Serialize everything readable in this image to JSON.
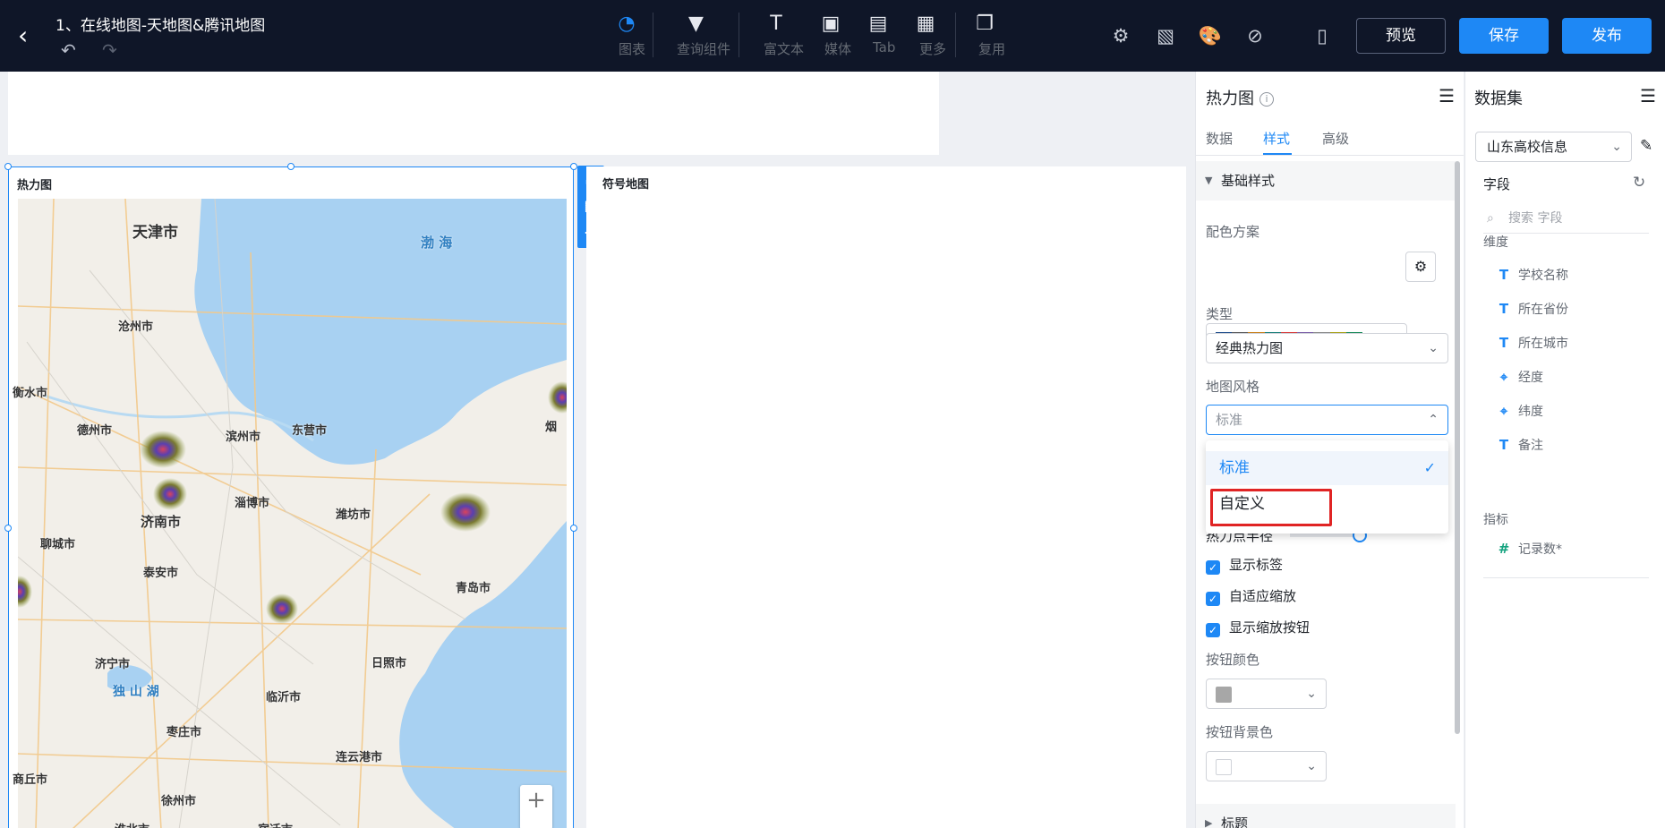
{
  "app": {
    "title": "1、在线地图-天地图&腾讯地图",
    "back_icon": "‹",
    "undo_icon": "↶",
    "redo_icon": "↷"
  },
  "toolbar": {
    "tools": [
      {
        "label": "图表",
        "icon": "◔"
      },
      {
        "label": "查询组件",
        "icon": "▼"
      },
      {
        "label": "富文本",
        "icon": "T"
      },
      {
        "label": "媒体",
        "icon": "▣"
      },
      {
        "label": "Tab",
        "icon": "▤"
      },
      {
        "label": "更多",
        "icon": "▦"
      },
      {
        "label": "复用",
        "icon": "❐"
      }
    ],
    "right_icons": [
      "⚙",
      "▧",
      "🎨",
      "⊘",
      "▯"
    ],
    "preview_label": "预览",
    "save_label": "保存",
    "publish_label": "发布"
  },
  "canvas": {
    "heatmap_card_title": "热力图",
    "second_card_title": "符号地图",
    "map_labels": [
      {
        "text": "天津市"
      },
      {
        "text": "渤 海"
      },
      {
        "text": "沧州市"
      },
      {
        "text": "衡水市"
      },
      {
        "text": "德州市"
      },
      {
        "text": "滨州市"
      },
      {
        "text": "东营市"
      },
      {
        "text": "淄博市"
      },
      {
        "text": "潍坊市"
      },
      {
        "text": "济南市"
      },
      {
        "text": "聊城市"
      },
      {
        "text": "泰安市"
      },
      {
        "text": "济宁市"
      },
      {
        "text": "独 山 湖"
      },
      {
        "text": "日照市"
      },
      {
        "text": "临沂市"
      },
      {
        "text": "枣庄市"
      },
      {
        "text": "连云港市"
      },
      {
        "text": "徐州市"
      },
      {
        "text": "淮北市"
      },
      {
        "text": "宿迁市"
      },
      {
        "text": "商丘市"
      },
      {
        "text": "烟"
      },
      {
        "text": "青岛市"
      }
    ],
    "side_tool_icons": [
      "⤢",
      "▤",
      "⋯"
    ],
    "zoom_icon": "+"
  },
  "config": {
    "header": "热力图",
    "info_icon": "i",
    "menu_icon": "☰",
    "tabs": [
      "数据",
      "样式",
      "高级"
    ],
    "active_tab": "样式",
    "section_basic": "基础样式",
    "palette_label": "配色方案",
    "palette_colors": [
      "#1f4e8c",
      "#5a5a5a",
      "#c77f1a",
      "#1a7f7a",
      "#d63b3b",
      "#7b5ea7",
      "#8a8a8a",
      "#a8a21a",
      "#1a8a5a"
    ],
    "type_label": "类型",
    "type_value": "经典热力图",
    "mapstyle_label": "地图风格",
    "mapstyle_value": "标准",
    "dropdown_options": [
      "标准",
      "自定义"
    ],
    "check_icon": "✓",
    "radius_label": "热力点半径",
    "checkbox_labels": [
      "显示标签",
      "自适应缩放",
      "显示缩放按钮"
    ],
    "button_color_label": "按钮颜色",
    "button_bg_label": "按钮背景色",
    "button_color_swatch": "#a7a7a7",
    "button_bg_swatch": "#ffffff",
    "section_title": "标题"
  },
  "dataset": {
    "header": "数据集",
    "menu_icon": "☰",
    "selected_dataset": "山东高校信息",
    "edit_icon": "✎",
    "fields_label": "字段",
    "refresh_icon": "↻",
    "search_placeholder": "搜索 字段",
    "search_icon": "⌕",
    "dimension_label": "维度",
    "dimensions": [
      {
        "name": "学校名称",
        "icon": "T"
      },
      {
        "name": "所在省份",
        "icon": "T"
      },
      {
        "name": "所在城市",
        "icon": "T"
      },
      {
        "name": "经度",
        "icon": "⌖"
      },
      {
        "name": "纬度",
        "icon": "⌖"
      },
      {
        "name": "备注",
        "icon": "T"
      }
    ],
    "measure_label": "指标",
    "measures": [
      {
        "name": "记录数*",
        "icon": "#"
      }
    ]
  }
}
